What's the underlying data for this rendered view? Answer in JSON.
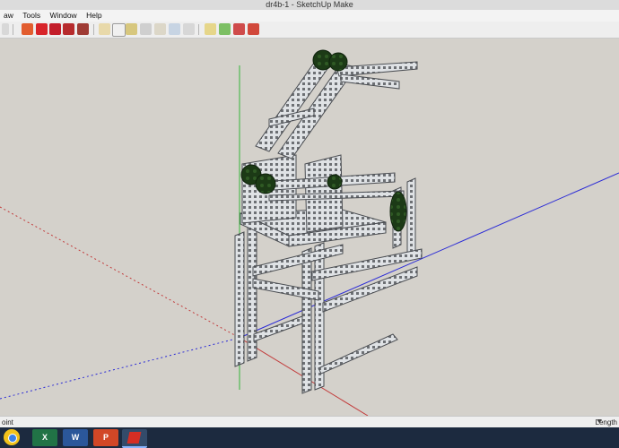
{
  "window": {
    "title": "dr4b-1 - SketchUp Make"
  },
  "menu": {
    "items": [
      "aw",
      "Tools",
      "Window",
      "Help"
    ]
  },
  "toolbar": {
    "icons": [
      "dropdown-icon",
      "paint-bucket-icon",
      "move-icon",
      "rotate-icon",
      "scale-icon",
      "push-pull-icon",
      "text-icon",
      "dimension-icon",
      "protractor-icon",
      "orbit-icon",
      "pan-icon",
      "zoom-icon",
      "zoom-extents-icon",
      "components-icon",
      "styles-icon",
      "warehouse-icon",
      "extension-icon"
    ]
  },
  "status": {
    "left": "oint",
    "right": "Length"
  },
  "taskbar": {
    "apps": [
      {
        "name": "Chrome",
        "label": ""
      },
      {
        "name": "Excel",
        "label": "X"
      },
      {
        "name": "Word",
        "label": "W"
      },
      {
        "name": "PowerPoint",
        "label": "P"
      },
      {
        "name": "SketchUp",
        "label": ""
      }
    ]
  },
  "colors": {
    "model_metal": "#8f9296",
    "gear_green": "#1d3d18",
    "axis_green": "#35b53a",
    "axis_blue": "#2b2bd6",
    "axis_red": "#c23b3b"
  }
}
